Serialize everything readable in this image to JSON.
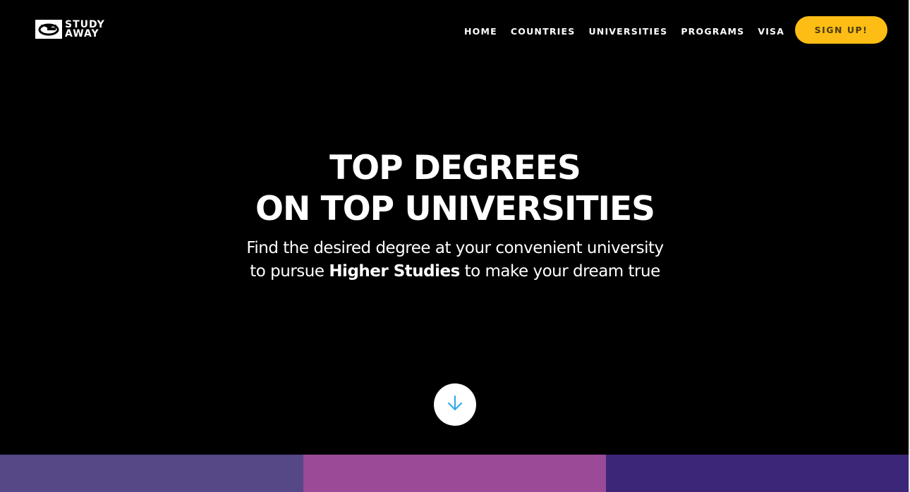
{
  "brand": {
    "name_line1": "STUDY",
    "name_line2": "AWAY",
    "icon": "graduation-cap-logo-icon"
  },
  "nav": {
    "items": [
      {
        "label": "HOME"
      },
      {
        "label": "COUNTRIES"
      },
      {
        "label": "UNIVERSITIES"
      },
      {
        "label": "PROGRAMS"
      },
      {
        "label": "VISA"
      }
    ],
    "signup_label": "SIGN UP!"
  },
  "hero": {
    "title_line1": "TOP DEGREES",
    "title_line2": "ON TOP UNIVERSITIES",
    "subtitle_before": "Find the desired degree at your convenient university to pursue ",
    "subtitle_bold": "Higher Studies",
    "subtitle_after": " to make your dream true",
    "scroll_icon": "arrow-down-icon"
  },
  "colors": {
    "background": "#000000",
    "accent": "#fdbd14",
    "scroll_arrow": "#2aa8e8",
    "block1": "#564787",
    "block2": "#9b4a98",
    "block3": "#3c2677"
  }
}
